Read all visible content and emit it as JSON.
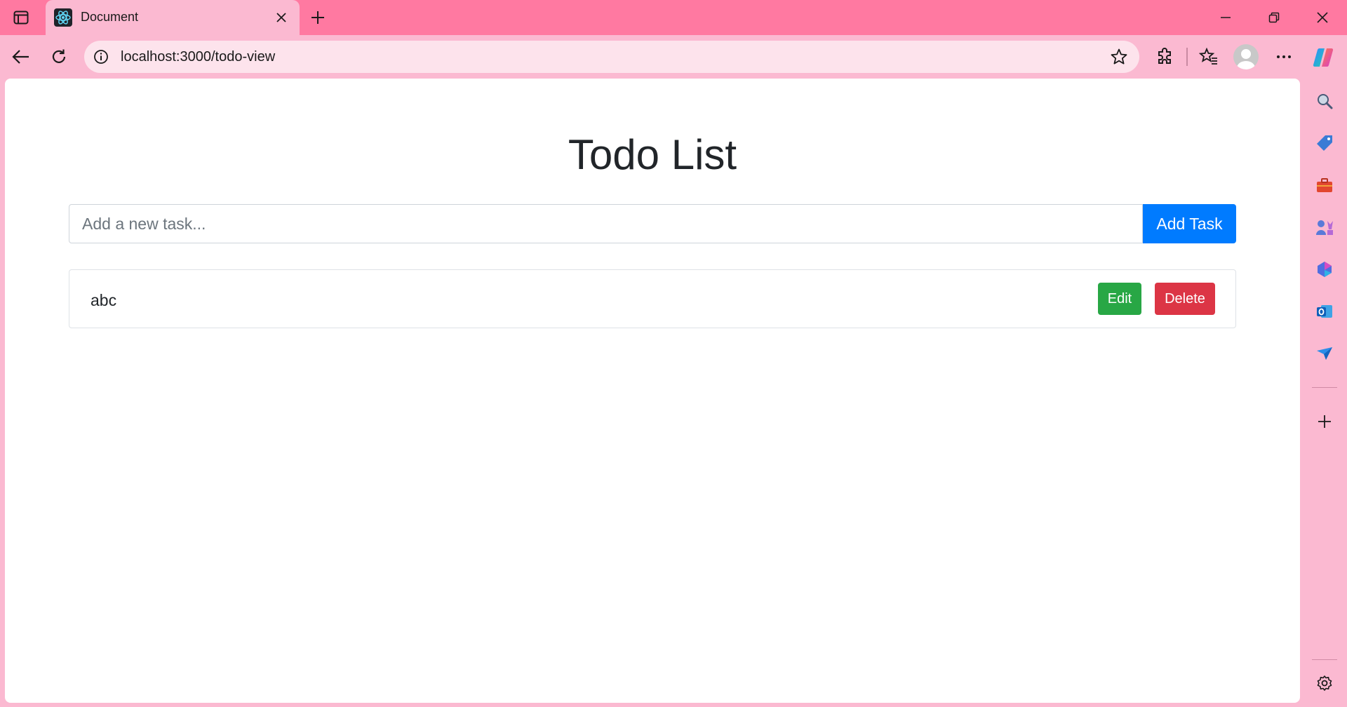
{
  "browser": {
    "tab": {
      "title": "Document",
      "favicon": "react-icon"
    },
    "address_bar": {
      "url": "localhost:3000/todo-view"
    },
    "window_controls": [
      "minimize-icon",
      "restore-icon",
      "close-icon"
    ],
    "toolbar_icons": [
      "back-arrow-icon",
      "reload-icon",
      "extensions-icon",
      "favorites-icon",
      "profile-avatar",
      "more-icon",
      "copilot-icon"
    ],
    "sidebar_icons": [
      "search-icon",
      "shopping-tag-icon",
      "tools-icon",
      "games-icon",
      "microsoft-365-icon",
      "outlook-icon",
      "send-icon",
      "add-icon",
      "settings-icon"
    ],
    "colors": {
      "frame": "#ff79a1",
      "toolbar": "#fbb9d1",
      "address_bar": "#fde3ec"
    }
  },
  "page": {
    "title": "Todo List",
    "input": {
      "placeholder": "Add a new task...",
      "value": ""
    },
    "add_button": "Add Task",
    "todos": [
      {
        "text": "abc",
        "edit_label": "Edit",
        "delete_label": "Delete"
      }
    ],
    "colors": {
      "primary": "#007bff",
      "success": "#28a745",
      "danger": "#dc3545"
    }
  }
}
